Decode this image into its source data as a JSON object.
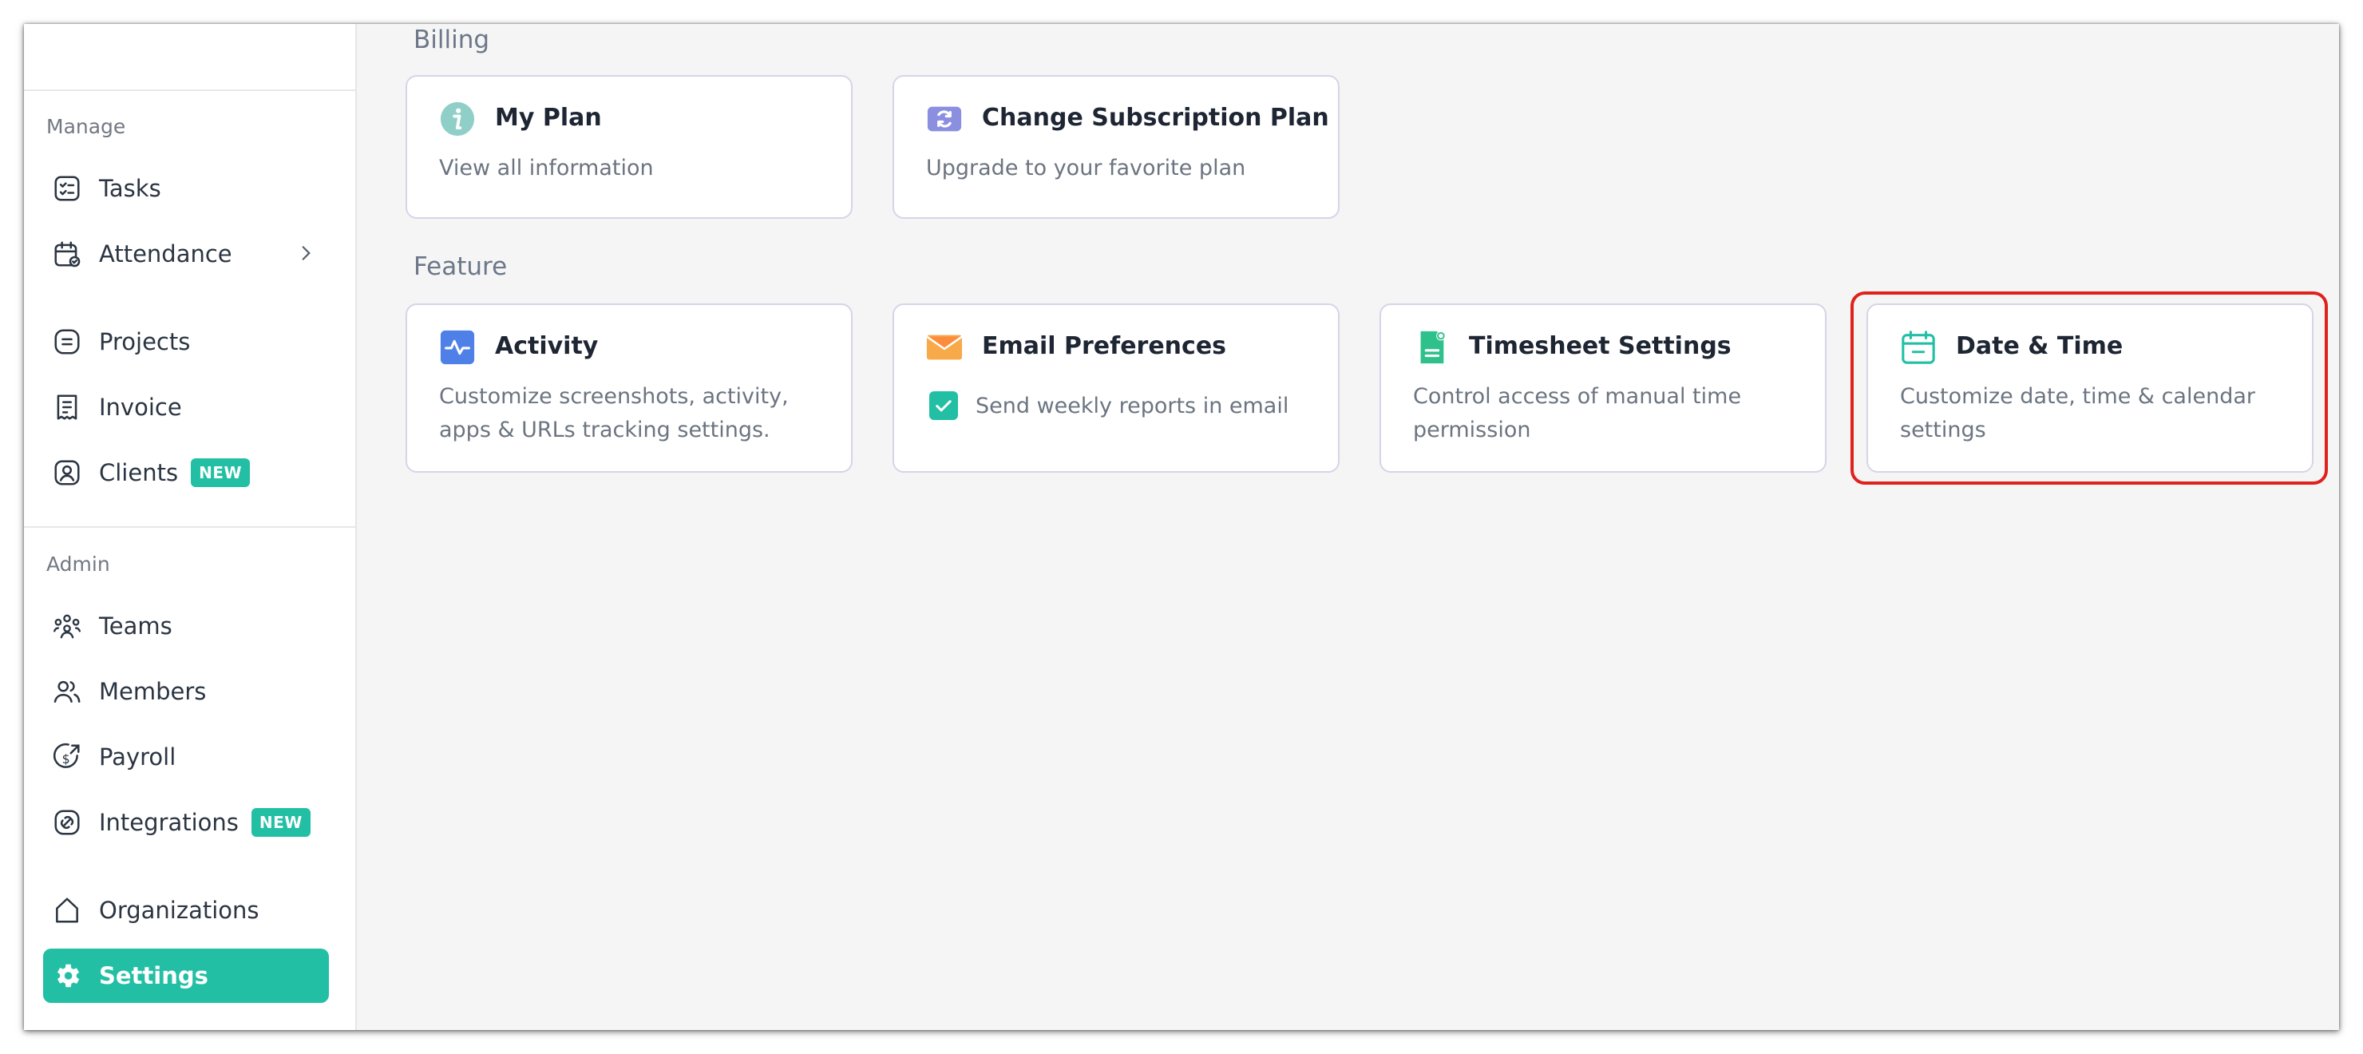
{
  "sidebar": {
    "manage_label": "Manage",
    "admin_label": "Admin",
    "items": [
      {
        "label": "Tasks",
        "icon": "tasks-icon"
      },
      {
        "label": "Attendance",
        "icon": "attendance-icon"
      },
      {
        "label": "Projects",
        "icon": "projects-icon"
      },
      {
        "label": "Invoice",
        "icon": "invoice-icon"
      },
      {
        "label": "Clients",
        "icon": "clients-icon",
        "badge": "NEW"
      },
      {
        "label": "Teams",
        "icon": "teams-icon"
      },
      {
        "label": "Members",
        "icon": "members-icon"
      },
      {
        "label": "Payroll",
        "icon": "payroll-icon"
      },
      {
        "label": "Integrations",
        "icon": "integrations-icon",
        "badge": "NEW"
      },
      {
        "label": "Organizations",
        "icon": "organizations-icon"
      },
      {
        "label": "Settings",
        "icon": "gear-icon",
        "active": true
      }
    ],
    "accent_color": "#22bfa5"
  },
  "billing": {
    "title": "Billing",
    "cards": [
      {
        "title": "My Plan",
        "desc": "View all information",
        "icon": "info-icon"
      },
      {
        "title": "Change Subscription Plan",
        "desc": "Upgrade to your favorite plan",
        "icon": "subscription-icon"
      }
    ]
  },
  "feature": {
    "title": "Feature",
    "cards": [
      {
        "title": "Activity",
        "desc": "Customize screenshots, activity, apps & URLs tracking settings.",
        "icon": "activity-icon"
      },
      {
        "title": "Email Preferences",
        "checkbox_label": "Send weekly reports in email",
        "checked": true,
        "icon": "email-icon"
      },
      {
        "title": "Timesheet Settings",
        "desc": "Control access of manual time permission",
        "icon": "timesheet-icon"
      },
      {
        "title": "Date & Time",
        "desc": "Customize date, time & calendar settings",
        "icon": "calendar-icon"
      }
    ]
  },
  "highlight_color": "#e0221c"
}
